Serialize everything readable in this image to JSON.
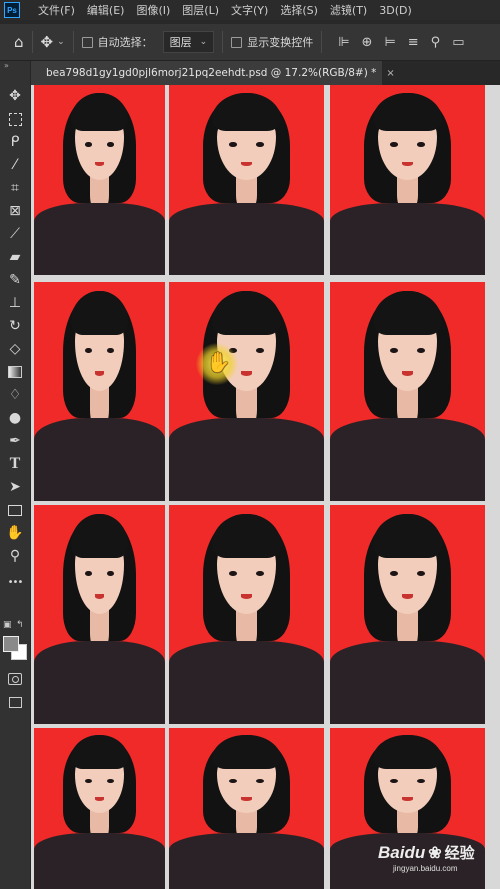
{
  "app": {
    "logo": "Ps"
  },
  "menu": {
    "items": [
      "文件(F)",
      "编辑(E)",
      "图像(I)",
      "图层(L)",
      "文字(Y)",
      "选择(S)",
      "滤镜(T)",
      "3D(D)"
    ]
  },
  "options_bar": {
    "auto_select_label": "自动选择：",
    "layer_select_value": "图层",
    "show_transform_label": "显示变换控件"
  },
  "document_tab": {
    "title": "bea798d1gy1gd0pjl6morj21pq2eehdt.psd @ 17.2%(RGB/8#) *",
    "close": "×"
  },
  "toolbar": {
    "collapse": "»",
    "tools": [
      "move-tool-icon",
      "marquee-tool-icon",
      "lasso-tool-icon",
      "magic-wand-tool-icon",
      "crop-tool-icon",
      "frame-tool-icon",
      "eyedropper-tool-icon",
      "healing-brush-tool-icon",
      "brush-tool-icon",
      "clone-stamp-tool-icon",
      "history-brush-tool-icon",
      "eraser-tool-icon",
      "gradient-tool-icon",
      "blur-tool-icon",
      "dodge-tool-icon",
      "pen-tool-icon",
      "type-tool-icon",
      "path-selection-tool-icon",
      "rectangle-tool-icon",
      "hand-tool-icon",
      "zoom-tool-icon",
      "more-tools-icon",
      "quick-mask-icon",
      "screen-mode-icon"
    ],
    "type_glyph": "T",
    "more_glyph": "•••"
  },
  "canvas": {
    "photo_background": "#ef2a28",
    "grid_columns": 3,
    "grid_rows": 4
  },
  "watermark": {
    "brand": "Baidu",
    "product": "经验",
    "url": "jingyan.baidu.com"
  },
  "colors": {
    "accent": "#31a8ff",
    "photo_bg": "#ef2a28",
    "ui_dark": "#323232"
  }
}
